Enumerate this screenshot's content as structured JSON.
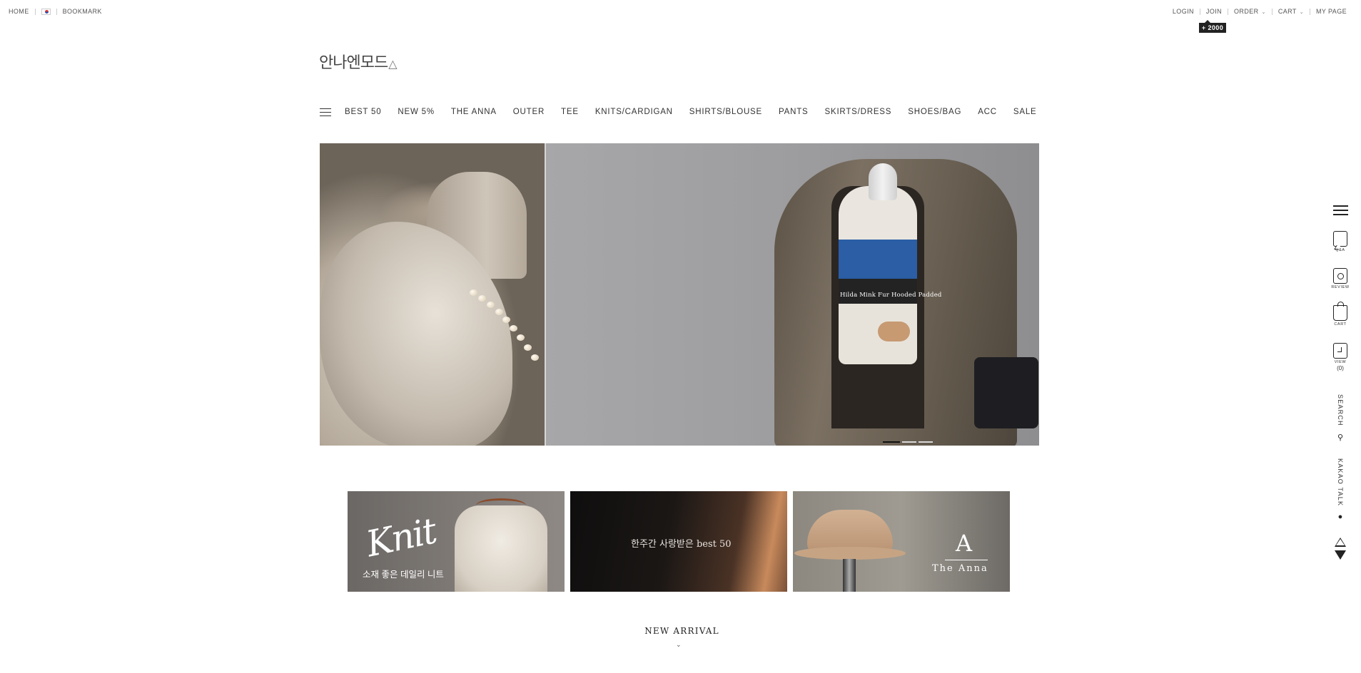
{
  "topbar": {
    "left": {
      "home": "HOME",
      "bookmark": "BOOKMARK"
    },
    "right": {
      "login": "LOGIN",
      "join": "JOIN",
      "join_points": "+ 2000",
      "order": "ORDER",
      "cart": "CART",
      "mypage": "MY PAGE"
    }
  },
  "logo": {
    "text": "안나엔모드"
  },
  "nav": {
    "items": [
      "BEST 50",
      "NEW 5%",
      "THE ANNA",
      "OUTER",
      "TEE",
      "KNITS/CARDIGAN",
      "SHIRTS/BLOUSE",
      "PANTS",
      "SKIRTS/DRESS",
      "SHOES/BAG",
      "ACC",
      "SALE"
    ]
  },
  "hero": {
    "caption": "Hilda Mink Fur Hooded Padded",
    "slide_count": 3,
    "active_slide": 1
  },
  "banners": {
    "knit": {
      "script": "Knit",
      "subtitle": "소재 좋은 데일리 니트"
    },
    "best": {
      "text": "한주간 사랑받은 best 50"
    },
    "anna": {
      "letter": "A",
      "name": "The Anna"
    }
  },
  "section": {
    "title": "NEW ARRIVAL"
  },
  "quickbar": {
    "qna_label": "Q&A",
    "review_label": "REVIEW",
    "cart_label": "CART",
    "view_label": "VIEW",
    "view_count": "(0)",
    "search_label": "SEARCH",
    "kakao_label": "KAKAO TALK"
  },
  "colors": {
    "accent": "#222222",
    "points_badge": "#222222"
  },
  "icons": [
    "menu-icon",
    "qna-icon",
    "review-icon",
    "cart-icon",
    "view-icon",
    "search-icon",
    "kakao-icon",
    "scroll-up-icon",
    "scroll-down-icon",
    "flag-icon"
  ]
}
